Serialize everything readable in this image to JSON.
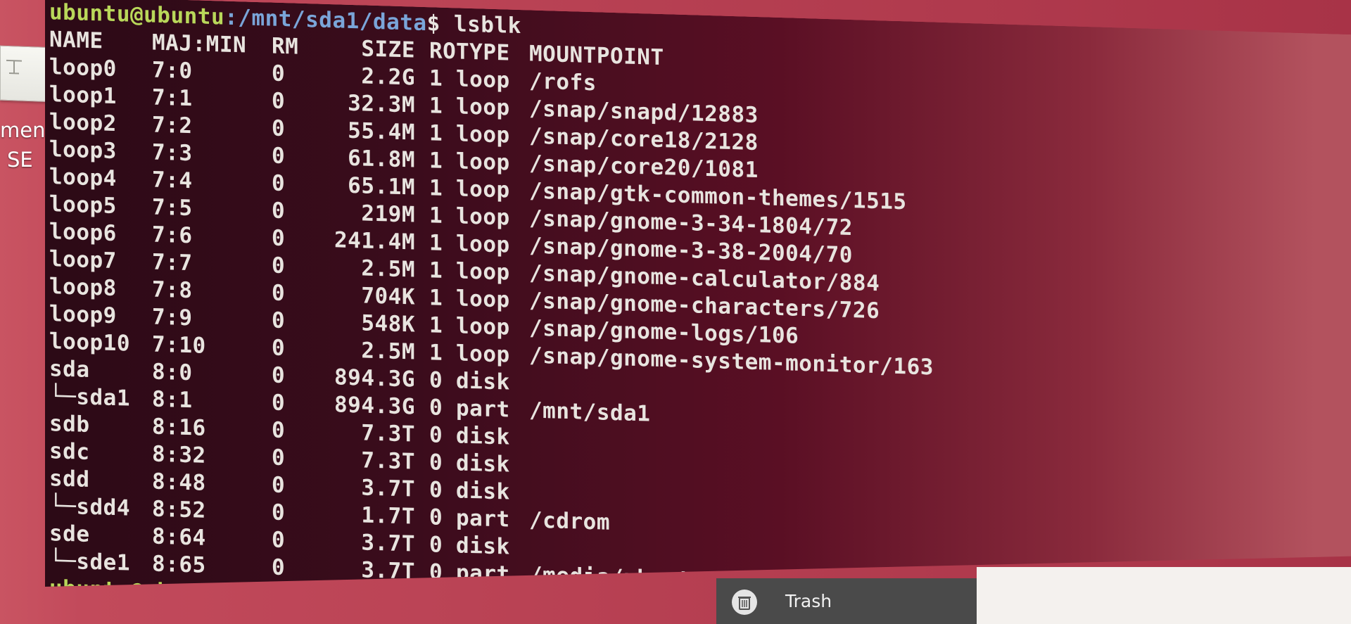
{
  "desktop": {
    "icon_labels": [
      "ment",
      "SE"
    ],
    "trash_label": "Trash"
  },
  "terminal": {
    "prompt": {
      "user_host": "ubuntu@ubuntu",
      "path": ":/mnt/sda1/data",
      "sigil": "$"
    },
    "command": " lsblk",
    "headers": [
      "NAME",
      "MAJ:MIN",
      "RM",
      "SIZE",
      "RO",
      "TYPE",
      "MOUNTPOINT"
    ],
    "rows": [
      {
        "name": "loop0",
        "majmin": "7:0",
        "rm": "0",
        "size": "2.2G",
        "ro": "1",
        "type": "loop",
        "mount": "/rofs"
      },
      {
        "name": "loop1",
        "majmin": "7:1",
        "rm": "0",
        "size": "32.3M",
        "ro": "1",
        "type": "loop",
        "mount": "/snap/snapd/12883"
      },
      {
        "name": "loop2",
        "majmin": "7:2",
        "rm": "0",
        "size": "55.4M",
        "ro": "1",
        "type": "loop",
        "mount": "/snap/core18/2128"
      },
      {
        "name": "loop3",
        "majmin": "7:3",
        "rm": "0",
        "size": "61.8M",
        "ro": "1",
        "type": "loop",
        "mount": "/snap/core20/1081"
      },
      {
        "name": "loop4",
        "majmin": "7:4",
        "rm": "0",
        "size": "65.1M",
        "ro": "1",
        "type": "loop",
        "mount": "/snap/gtk-common-themes/1515"
      },
      {
        "name": "loop5",
        "majmin": "7:5",
        "rm": "0",
        "size": "219M",
        "ro": "1",
        "type": "loop",
        "mount": "/snap/gnome-3-34-1804/72"
      },
      {
        "name": "loop6",
        "majmin": "7:6",
        "rm": "0",
        "size": "241.4M",
        "ro": "1",
        "type": "loop",
        "mount": "/snap/gnome-3-38-2004/70"
      },
      {
        "name": "loop7",
        "majmin": "7:7",
        "rm": "0",
        "size": "2.5M",
        "ro": "1",
        "type": "loop",
        "mount": "/snap/gnome-calculator/884"
      },
      {
        "name": "loop8",
        "majmin": "7:8",
        "rm": "0",
        "size": "704K",
        "ro": "1",
        "type": "loop",
        "mount": "/snap/gnome-characters/726"
      },
      {
        "name": "loop9",
        "majmin": "7:9",
        "rm": "0",
        "size": "548K",
        "ro": "1",
        "type": "loop",
        "mount": "/snap/gnome-logs/106"
      },
      {
        "name": "loop10",
        "majmin": "7:10",
        "rm": "0",
        "size": "2.5M",
        "ro": "1",
        "type": "loop",
        "mount": "/snap/gnome-system-monitor/163"
      },
      {
        "name": "sda",
        "majmin": "8:0",
        "rm": "0",
        "size": "894.3G",
        "ro": "0",
        "type": "disk",
        "mount": ""
      },
      {
        "name": "└─sda1",
        "majmin": "8:1",
        "rm": "0",
        "size": "894.3G",
        "ro": "0",
        "type": "part",
        "mount": "/mnt/sda1"
      },
      {
        "name": "sdb",
        "majmin": "8:16",
        "rm": "0",
        "size": "7.3T",
        "ro": "0",
        "type": "disk",
        "mount": ""
      },
      {
        "name": "sdc",
        "majmin": "8:32",
        "rm": "0",
        "size": "7.3T",
        "ro": "0",
        "type": "disk",
        "mount": ""
      },
      {
        "name": "sdd",
        "majmin": "8:48",
        "rm": "0",
        "size": "3.7T",
        "ro": "0",
        "type": "disk",
        "mount": ""
      },
      {
        "name": "└─sdd4",
        "majmin": "8:52",
        "rm": "0",
        "size": "1.7T",
        "ro": "0",
        "type": "part",
        "mount": "/cdrom"
      },
      {
        "name": "sde",
        "majmin": "8:64",
        "rm": "0",
        "size": "3.7T",
        "ro": "0",
        "type": "disk",
        "mount": ""
      },
      {
        "name": "└─sde1",
        "majmin": "8:65",
        "rm": "0",
        "size": "3.7T",
        "ro": "0",
        "type": "part",
        "mount": "/media/ubuntu/Elements SE"
      }
    ]
  },
  "colors": {
    "prompt_user": "#b9d85a",
    "prompt_path": "#7aa5d9",
    "terminal_text": "#e8e4df"
  }
}
